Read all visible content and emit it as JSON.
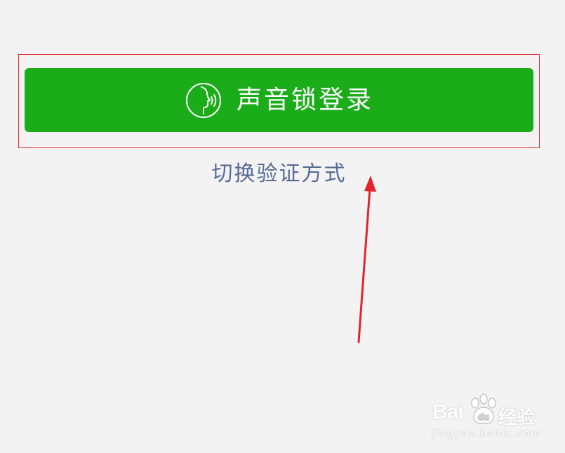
{
  "voice_login": {
    "label": "声音锁登录",
    "icon": "voice-face-icon",
    "bg_color": "#1aad19",
    "text_color": "#ffffff"
  },
  "switch_method": {
    "label": "切换验证方式",
    "color": "#576b95"
  },
  "annotation": {
    "highlight_color": "#e4242d",
    "arrow_color": "#e4242d"
  },
  "watermark": {
    "brand": "Bai",
    "brand_mid": "du",
    "brand_cn": "经验",
    "domain": "jingyan.baidu.com"
  }
}
